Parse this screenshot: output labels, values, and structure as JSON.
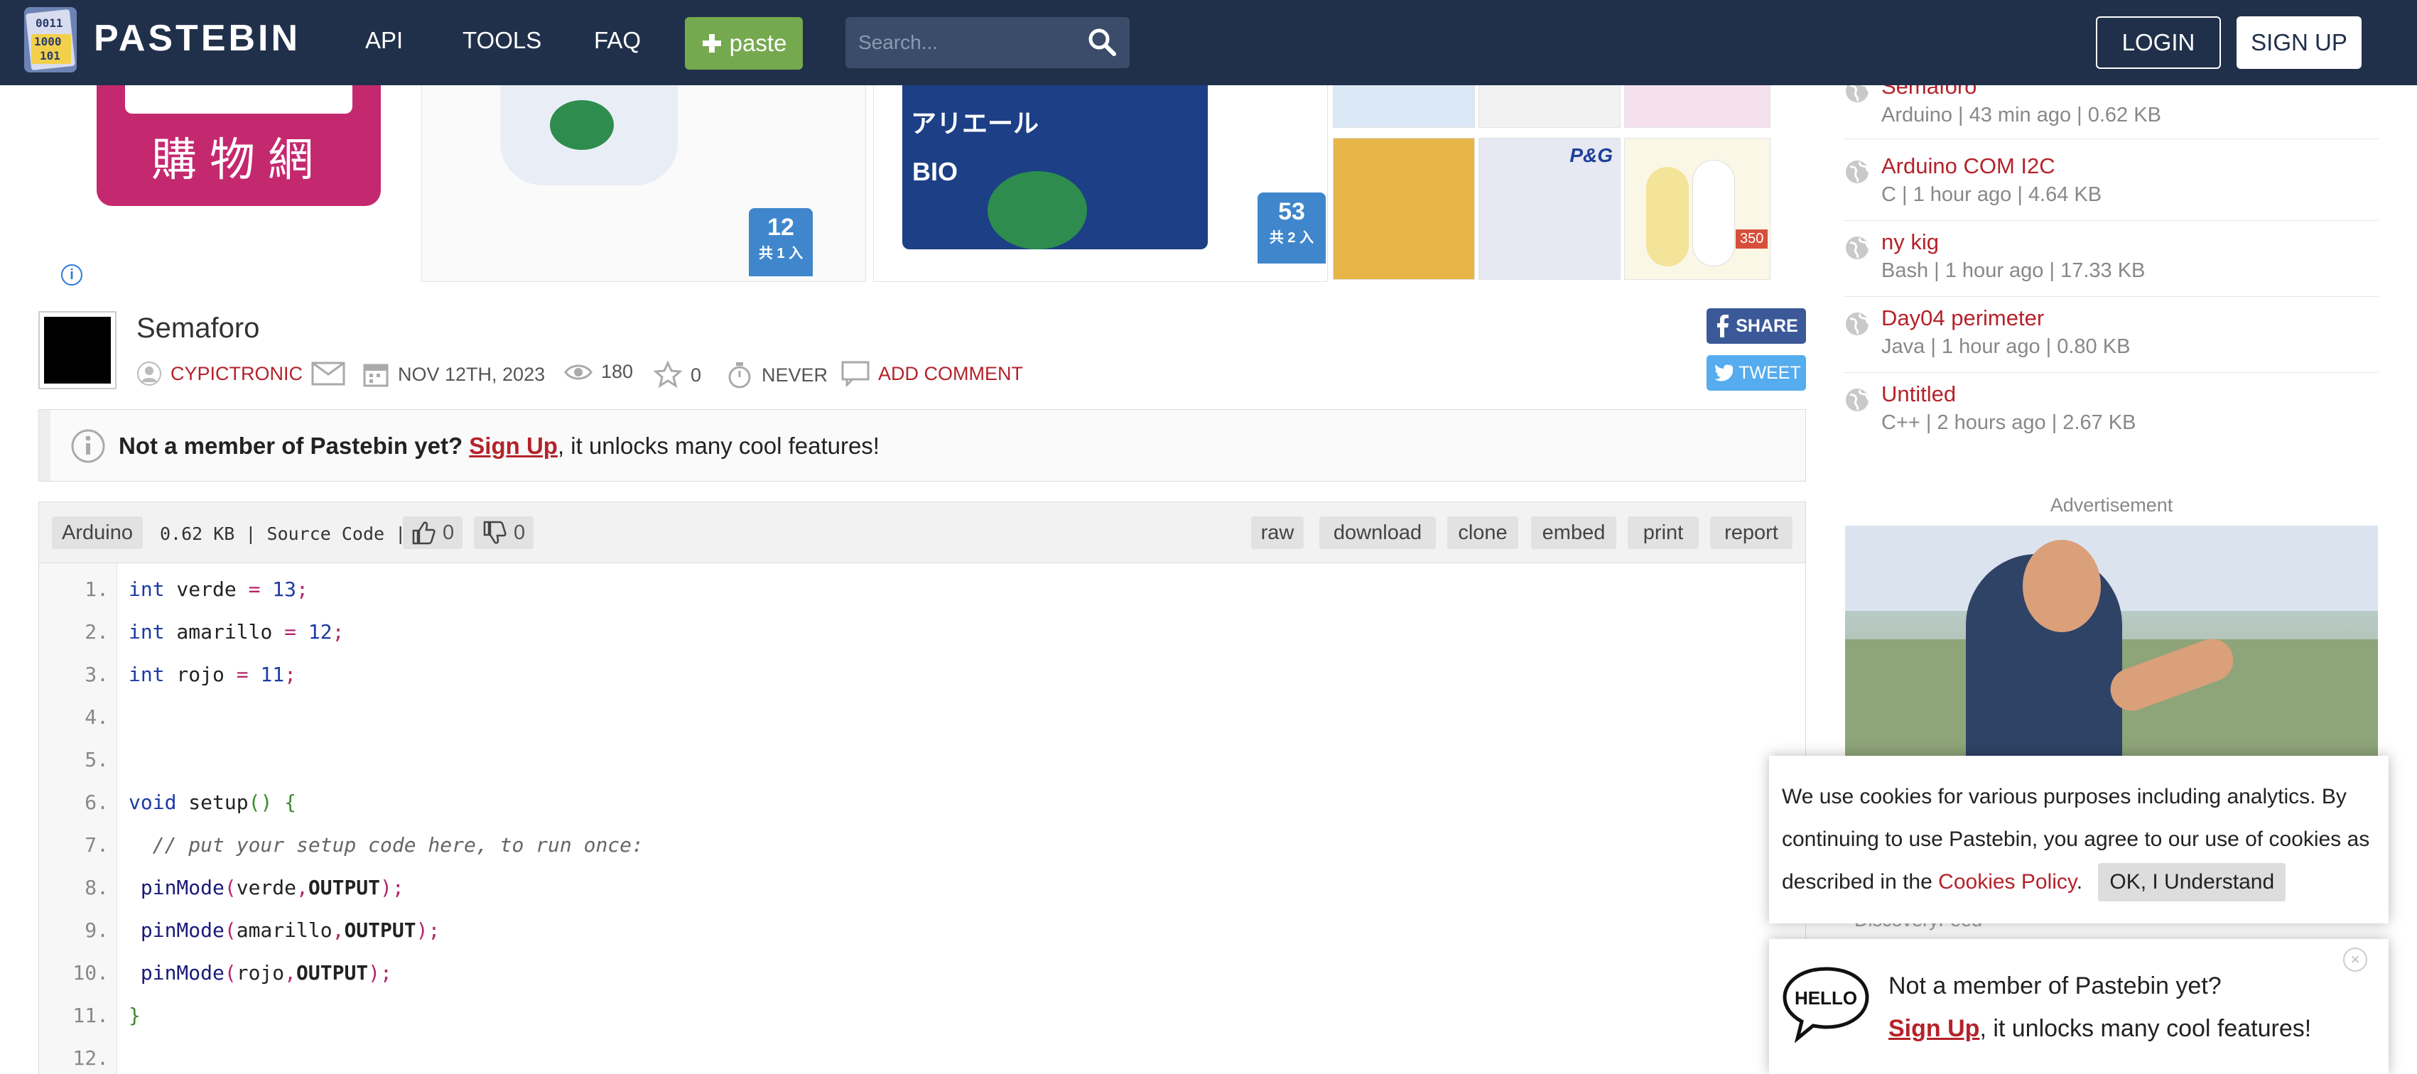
{
  "header": {
    "logo_text": "PASTEBIN",
    "logo_icon_text": [
      "0011",
      "1000",
      "101"
    ],
    "nav": [
      "API",
      "TOOLS",
      "FAQ"
    ],
    "paste_label": "paste",
    "search_placeholder": "Search...",
    "login": "LOGIN",
    "signup": "SIGN UP"
  },
  "ad_banner": {
    "mo_text": "購物網",
    "tiles": [
      {
        "text": "12",
        "unit": "共 1 入"
      },
      {
        "text": "アリエール"
      },
      {
        "text": "BIO"
      },
      {
        "text": "53",
        "unit": "共 2 入"
      },
      {
        "text": "P&G"
      },
      {
        "text": "350"
      }
    ]
  },
  "paste": {
    "title": "Semaforo",
    "author": "CYPICTRONIC",
    "date": "NOV 12TH, 2023",
    "views": "180",
    "stars": "0",
    "expires": "NEVER",
    "add_comment": "ADD COMMENT",
    "share": "SHARE",
    "tweet": "TWEET"
  },
  "notice": {
    "lead": "Not a member of Pastebin yet?",
    "link": "Sign Up",
    "tail": ", it unlocks many cool features!"
  },
  "code_toolbar": {
    "language": "Arduino",
    "size_info": "0.62 KB | Source Code |",
    "likes": "0",
    "dislikes": "0",
    "actions": [
      "raw",
      "download",
      "clone",
      "embed",
      "print",
      "report"
    ]
  },
  "code": {
    "line_numbers": [
      "1.",
      "2.",
      "3.",
      "4.",
      "5.",
      "6.",
      "7.",
      "8.",
      "9.",
      "10.",
      "11.",
      "12."
    ],
    "l1": {
      "kw": "int",
      "name": " verde ",
      "op": "=",
      "num": " 13",
      "end": ";"
    },
    "l2": {
      "kw": "int",
      "name": " amarillo ",
      "op": "=",
      "num": " 12",
      "end": ";"
    },
    "l3": {
      "kw": "int",
      "name": " rojo ",
      "op": "=",
      "num": " 11",
      "end": ";"
    },
    "l6": {
      "kw": "void",
      "name": " setup",
      "paren": "()",
      "brace": " {"
    },
    "l7": {
      "comment": "  // put your setup code here, to run once:"
    },
    "l8": {
      "fn": " pinMode",
      "open": "(",
      "arg": "verde",
      "comma": ",",
      "const": "OUTPUT",
      "close": ");"
    },
    "l9": {
      "fn": " pinMode",
      "open": "(",
      "arg": "amarillo",
      "comma": ",",
      "const": "OUTPUT",
      "close": ");"
    },
    "l10": {
      "fn": " pinMode",
      "open": "(",
      "arg": "rojo",
      "comma": ",",
      "const": "OUTPUT",
      "close": ");"
    },
    "l11": {
      "brace": "}"
    }
  },
  "sidebar": {
    "recent": [
      {
        "title": "Semaforo",
        "meta": "Arduino | 43 min ago | 0.62 KB"
      },
      {
        "title": "Arduino COM I2C",
        "meta": "C | 1 hour ago | 4.64 KB"
      },
      {
        "title": "ny kig",
        "meta": "Bash | 1 hour ago | 17.33 KB"
      },
      {
        "title": "Day04 perimeter",
        "meta": "Java | 1 hour ago | 0.80 KB"
      },
      {
        "title": "Untitled",
        "meta": "C++ | 2 hours ago | 2.67 KB"
      }
    ],
    "advertisement_label": "Advertisement",
    "discovery_label": "DiscoveryFeed"
  },
  "cookie": {
    "text": "We use cookies for various purposes including analytics. By continuing to use Pastebin, you agree to our use of cookies as described in the",
    "link": "Cookies Policy",
    "after_link": ".",
    "button": "OK, I Understand"
  },
  "hello_popup": {
    "bubble_text": "HELLO",
    "lead": "Not a member of Pastebin yet?",
    "link": "Sign Up",
    "tail": ", it unlocks many cool features!",
    "close": "×"
  },
  "colors": {
    "header_bg": "#20304a",
    "paste_green": "#75a94f",
    "link_red": "#b5222a",
    "share_blue": "#3b5998",
    "tweet_blue": "#55acee",
    "ad_magenta": "#c4296f"
  }
}
